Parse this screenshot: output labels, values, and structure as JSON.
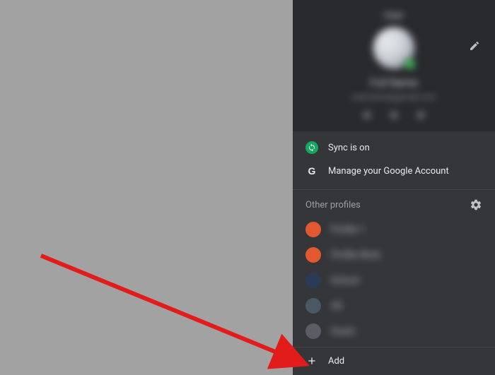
{
  "card": {
    "username": "User",
    "fullname": "Full Name",
    "email": "username@gmail.com"
  },
  "menu": {
    "sync_label": "Sync is on",
    "manage_label": "Manage your Google Account",
    "google_glyph": "G"
  },
  "section": {
    "other_profiles": "Other profiles"
  },
  "profiles": [
    {
      "label": "Profile 1",
      "color": "#e2582f"
    },
    {
      "label": "Profile Work",
      "color": "#e2582f"
    },
    {
      "label": "School",
      "color": "#2b3a55"
    },
    {
      "label": "Alt",
      "color": "#4a5866"
    },
    {
      "label": "Guest",
      "color": "#5a5d63"
    }
  ],
  "add": {
    "label": "Add"
  }
}
